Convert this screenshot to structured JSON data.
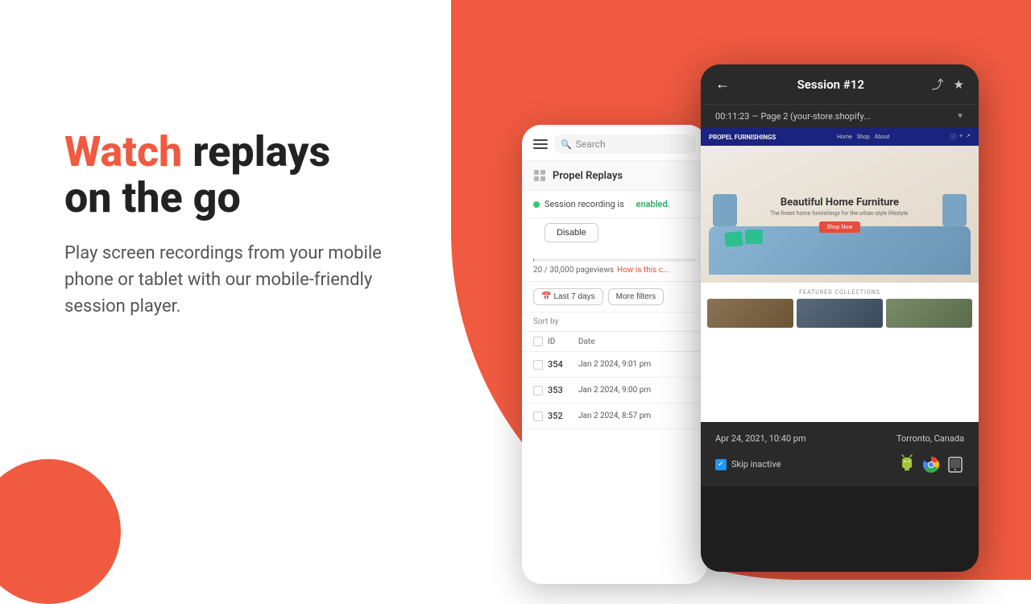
{
  "background": {
    "blob_top_color": "#f05a40",
    "blob_bottom_color": "#f05a40"
  },
  "left_content": {
    "headline_accent": "Watch",
    "headline_rest": " replays\non the go",
    "subtext": "Play screen recordings from your mobile phone or tablet with our mobile-friendly session player."
  },
  "phone_left": {
    "search_placeholder": "Search",
    "nav_item_label": "Propel Replays",
    "recording_status_text": "Session recording is",
    "enabled_label": "enabled.",
    "disable_button": "Disable",
    "progress_text": "20 / 30,000 pageviews",
    "how_link": "How is this c...",
    "filter_last7": "Last 7 days",
    "filter_more": "More filters",
    "sort_label": "Sort by",
    "table_col_id": "ID",
    "table_col_date": "Date",
    "rows": [
      {
        "id": "354",
        "date": "Jan 2 2024, 9:01 pm"
      },
      {
        "id": "353",
        "date": "Jan 2 2024, 9:00 pm"
      },
      {
        "id": "352",
        "date": "Jan 2 2024, 8:57 pm"
      }
    ]
  },
  "phone_right": {
    "session_title": "Session #12",
    "url_bar_text": "00:11:23 — Page 2 (your-store.shopify...",
    "hero_title": "Beautiful Home Furniture",
    "hero_subtitle": "The finest home furnishings for the urban-style lifestyle.",
    "cta_label": "Shop Now",
    "featured_label": "Featured Collections",
    "footer_date": "Apr 24, 2021, 10:40 pm",
    "footer_location": "Torronto, Canada",
    "skip_label": "Skip inactive",
    "shopify_logo": "PROPEL FURNISHINGS"
  }
}
